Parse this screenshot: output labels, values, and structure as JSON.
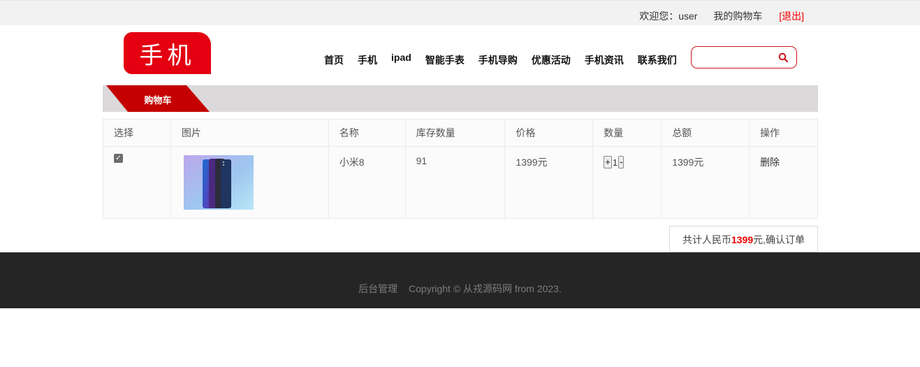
{
  "topbar": {
    "welcome": "欢迎您：user",
    "cart_link": "我的购物车",
    "logout": "[退出]"
  },
  "header": {
    "logo_text": "手机",
    "nav": [
      "首页",
      "手机",
      "ipad",
      "智能手表",
      "手机导购",
      "优惠活动",
      "手机资讯",
      "联系我们"
    ],
    "search": {
      "value": "",
      "icon": "search-icon"
    }
  },
  "breadcrumb": {
    "title": "购物车"
  },
  "cart": {
    "columns": [
      "选择",
      "图片",
      "名称",
      "库存数量",
      "价格",
      "数量",
      "总额",
      "操作"
    ],
    "rows": [
      {
        "checked": true,
        "image": "xiaomi-8-phone",
        "name": "小米8",
        "stock": "91",
        "price": "1399元",
        "plus": "+",
        "quantity": "1",
        "minus": "-",
        "total": "1399元",
        "action": "删除"
      }
    ]
  },
  "summary": {
    "prefix": "共计人民币",
    "amount": "1399",
    "suffix": "元,确认订单"
  },
  "footer": {
    "admin": "后台管理",
    "copyright": "Copyright © 从戎源码网 from 2023."
  },
  "colors": {
    "brand_red": "#e40011",
    "band": "#dbd9da",
    "footer": "#252525"
  }
}
